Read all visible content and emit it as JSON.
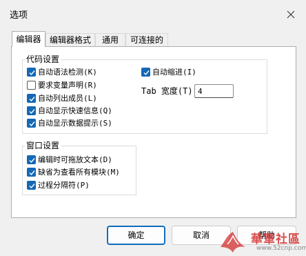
{
  "window": {
    "title": "选项"
  },
  "tabs": [
    {
      "label": "编辑器",
      "active": true
    },
    {
      "label": "编辑器格式",
      "active": false
    },
    {
      "label": "通用",
      "active": false
    },
    {
      "label": "可连接的",
      "active": false
    }
  ],
  "code_settings": {
    "title": "代码设置",
    "auto_syntax_check": {
      "label": "自动语法检测(K)",
      "checked": true
    },
    "require_variable_declaration": {
      "label": "要求变量声明(R)",
      "checked": false
    },
    "auto_list_members": {
      "label": "自动列出成员(L)",
      "checked": true
    },
    "auto_quick_info": {
      "label": "自动显示快速信息(Q)",
      "checked": true
    },
    "auto_data_tips": {
      "label": "自动显示数据提示(S)",
      "checked": true
    },
    "auto_indent": {
      "label": "自动缩进(I)",
      "checked": true
    },
    "tab_width": {
      "label": "Tab 宽度(T):",
      "value": "4"
    }
  },
  "window_settings": {
    "title": "窗口设置",
    "drag_drop_text_editing": {
      "label": "编辑时可拖放文本(D)",
      "checked": true
    },
    "default_full_module_view": {
      "label": "缺省为查看所有模块(M)",
      "checked": true
    },
    "procedure_separator": {
      "label": "过程分隔符(P)",
      "checked": true
    }
  },
  "buttons": {
    "ok": "确定",
    "cancel": "取消",
    "help": "帮助"
  },
  "watermark": {
    "site_name": "華軍社區",
    "url": "www.52cnp.com"
  },
  "colors": {
    "accent": "#1468b5",
    "primary_button_border": "#0f6cbd",
    "watermark": "#d32f2f"
  }
}
